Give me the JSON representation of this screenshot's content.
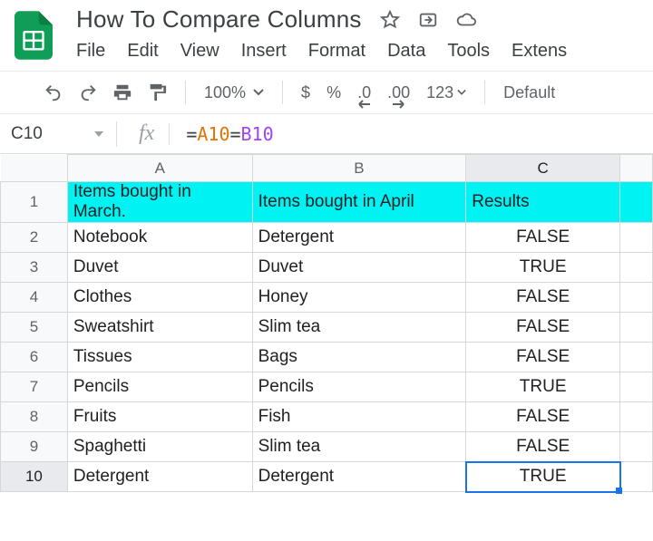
{
  "doc": {
    "title": "How To Compare Columns"
  },
  "menu": {
    "file": "File",
    "edit": "Edit",
    "view": "View",
    "insert": "Insert",
    "format": "Format",
    "data": "Data",
    "tools": "Tools",
    "extensions": "Extens"
  },
  "toolbar": {
    "zoom": "100%",
    "currency": "$",
    "percent": "%",
    "dec_less": ".0",
    "dec_more": ".00",
    "numfmt": "123",
    "font": "Default"
  },
  "fx": {
    "cell": "C10",
    "formula_eq": "=",
    "formula_a": "A10",
    "formula_op": "=",
    "formula_b": "B10"
  },
  "cols": {
    "A": "A",
    "B": "B",
    "C": "C"
  },
  "rows": {
    "r1": {
      "n": "1",
      "A": "Items bought in March.",
      "B": "Items bought in April",
      "C": "Results"
    },
    "r2": {
      "n": "2",
      "A": "Notebook",
      "B": "Detergent",
      "C": "FALSE"
    },
    "r3": {
      "n": "3",
      "A": "Duvet",
      "B": "Duvet",
      "C": "TRUE"
    },
    "r4": {
      "n": "4",
      "A": "Clothes",
      "B": "Honey",
      "C": "FALSE"
    },
    "r5": {
      "n": "5",
      "A": "Sweatshirt",
      "B": "Slim tea",
      "C": "FALSE"
    },
    "r6": {
      "n": "6",
      "A": "Tissues",
      "B": "Bags",
      "C": "FALSE"
    },
    "r7": {
      "n": "7",
      "A": "Pencils",
      "B": "Pencils",
      "C": "TRUE"
    },
    "r8": {
      "n": "8",
      "A": "Fruits",
      "B": "Fish",
      "C": "FALSE"
    },
    "r9": {
      "n": "9",
      "A": "Spaghetti",
      "B": "Slim tea",
      "C": "FALSE"
    },
    "r10": {
      "n": "10",
      "A": "Detergent",
      "B": "Detergent",
      "C": "TRUE"
    }
  }
}
